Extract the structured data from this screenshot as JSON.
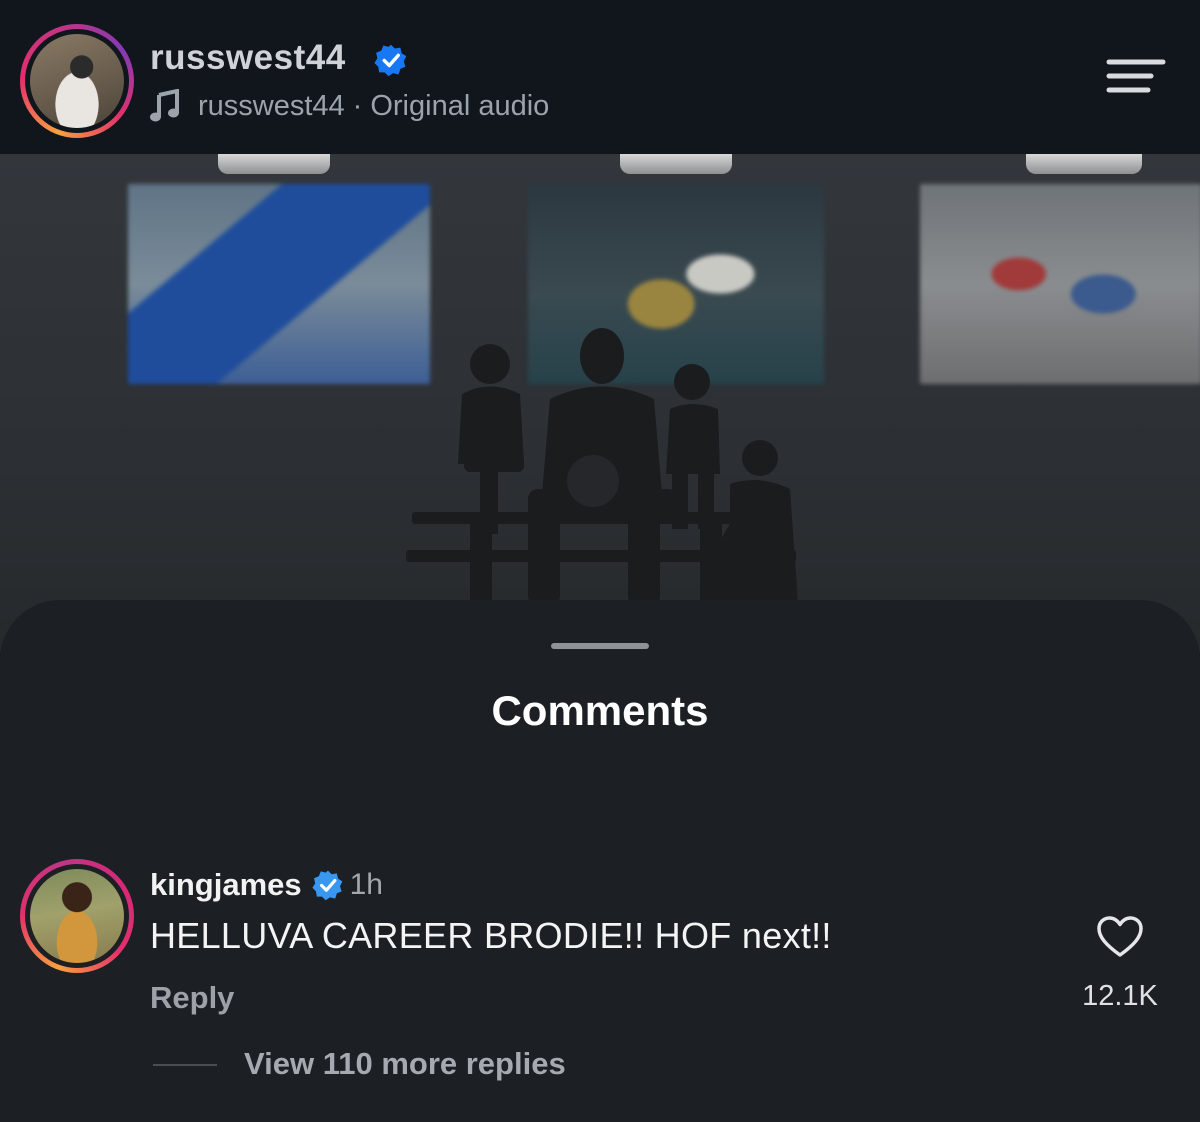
{
  "header": {
    "username": "russwest44",
    "audio_user": "russwest44",
    "audio_separator": "·",
    "audio_label": "Original audio",
    "avatar_icon": "profile-avatar",
    "menu_icon": "menu-icon"
  },
  "comments_sheet": {
    "title": "Comments",
    "comments": [
      {
        "username": "kingjames",
        "verified": true,
        "time": "1h",
        "text": "HELLUVA CAREER BRODIE!! HOF next!!",
        "reply_label": "Reply",
        "likes": "12.1K",
        "view_replies": "View 110 more replies"
      }
    ]
  },
  "colors": {
    "accent_verified": "#3897f0",
    "background": "#1c1f24",
    "header_bg": "#11151c",
    "story_ring_start": "#f9a03f",
    "story_ring_end": "#c13584"
  }
}
